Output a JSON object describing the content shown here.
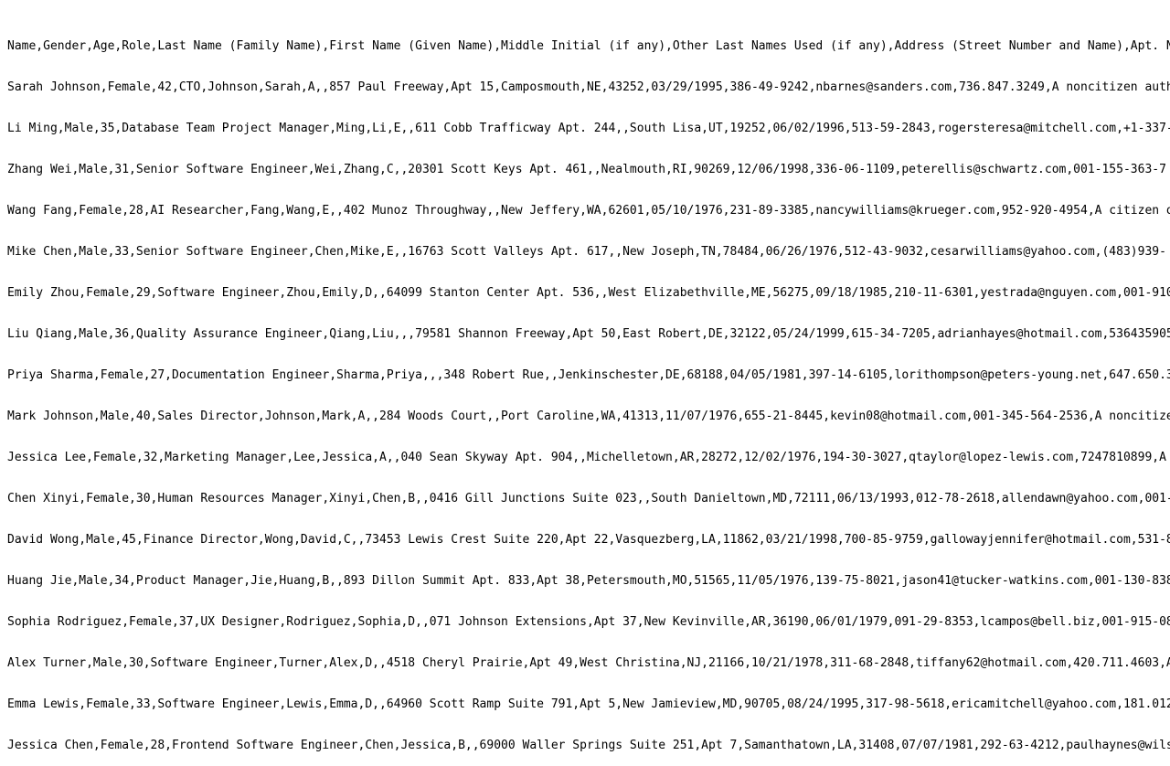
{
  "lines": [
    "Name,Gender,Age,Role,Last Name (Family Name),First Name (Given Name),Middle Initial (if any),Other Last Names Used (if any),Address (Street Number and Name),Apt. N",
    "Sarah Johnson,Female,42,CTO,Johnson,Sarah,A,,857 Paul Freeway,Apt 15,Camposmouth,NE,43252,03/29/1995,386-49-9242,nbarnes@sanders.com,736.847.3249,A noncitizen auth",
    "Li Ming,Male,35,Database Team Project Manager,Ming,Li,E,,611 Cobb Trafficway Apt. 244,,South Lisa,UT,19252,06/02/1996,513-59-2843,rogersteresa@mitchell.com,+1-337-",
    "Zhang Wei,Male,31,Senior Software Engineer,Wei,Zhang,C,,20301 Scott Keys Apt. 461,,Nealmouth,RI,90269,12/06/1998,336-06-1109,peterellis@schwartz.com,001-155-363-7",
    "Wang Fang,Female,28,AI Researcher,Fang,Wang,E,,402 Munoz Throughway,,New Jeffery,WA,62601,05/10/1976,231-89-3385,nancywilliams@krueger.com,952-920-4954,A citizen o",
    "Mike Chen,Male,33,Senior Software Engineer,Chen,Mike,E,,16763 Scott Valleys Apt. 617,,New Joseph,TN,78484,06/26/1976,512-43-9032,cesarwilliams@yahoo.com,(483)939-",
    "Emily Zhou,Female,29,Software Engineer,Zhou,Emily,D,,64099 Stanton Center Apt. 536,,West Elizabethville,ME,56275,09/18/1985,210-11-6301,yestrada@nguyen.com,001-910",
    "Liu Qiang,Male,36,Quality Assurance Engineer,Qiang,Liu,,,79581 Shannon Freeway,Apt 50,East Robert,DE,32122,05/24/1999,615-34-7205,adrianhayes@hotmail.com,536435905",
    "Priya Sharma,Female,27,Documentation Engineer,Sharma,Priya,,,348 Robert Rue,,Jenkinschester,DE,68188,04/05/1981,397-14-6105,lorithompson@peters-young.net,647.650.3",
    "Mark Johnson,Male,40,Sales Director,Johnson,Mark,A,,284 Woods Court,,Port Caroline,WA,41313,11/07/1976,655-21-8445,kevin08@hotmail.com,001-345-564-2536,A noncitize",
    "Jessica Lee,Female,32,Marketing Manager,Lee,Jessica,A,,040 Sean Skyway Apt. 904,,Michelletown,AR,28272,12/02/1976,194-30-3027,qtaylor@lopez-lewis.com,7247810899,A",
    "Chen Xinyi,Female,30,Human Resources Manager,Xinyi,Chen,B,,0416 Gill Junctions Suite 023,,South Danieltown,MD,72111,06/13/1993,012-78-2618,allendawn@yahoo.com,001-",
    "David Wong,Male,45,Finance Director,Wong,David,C,,73453 Lewis Crest Suite 220,Apt 22,Vasquezberg,LA,11862,03/21/1998,700-85-9759,gallowayjennifer@hotmail.com,531-8",
    "Huang Jie,Male,34,Product Manager,Jie,Huang,B,,893 Dillon Summit Apt. 833,Apt 38,Petersmouth,MO,51565,11/05/1976,139-75-8021,jason41@tucker-watkins.com,001-130-838",
    "Sophia Rodriguez,Female,37,UX Designer,Rodriguez,Sophia,D,,071 Johnson Extensions,Apt 37,New Kevinville,AR,36190,06/01/1979,091-29-8353,lcampos@bell.biz,001-915-08",
    "Alex Turner,Male,30,Software Engineer,Turner,Alex,D,,4518 Cheryl Prairie,Apt 49,West Christina,NJ,21166,10/21/1978,311-68-2848,tiffany62@hotmail.com,420.711.4603,A",
    "Emma Lewis,Female,33,Software Engineer,Lewis,Emma,D,,64960 Scott Ramp Suite 791,Apt 5,New Jamieview,MD,90705,08/24/1995,317-98-5618,ericamitchell@yahoo.com,181.012",
    "Jessica Chen,Female,28,Frontend Software Engineer,Chen,Jessica,B,,69000 Waller Springs Suite 251,Apt 7,Samanthatown,LA,31408,07/07/1981,292-63-4212,paulhaynes@wils"
  ]
}
